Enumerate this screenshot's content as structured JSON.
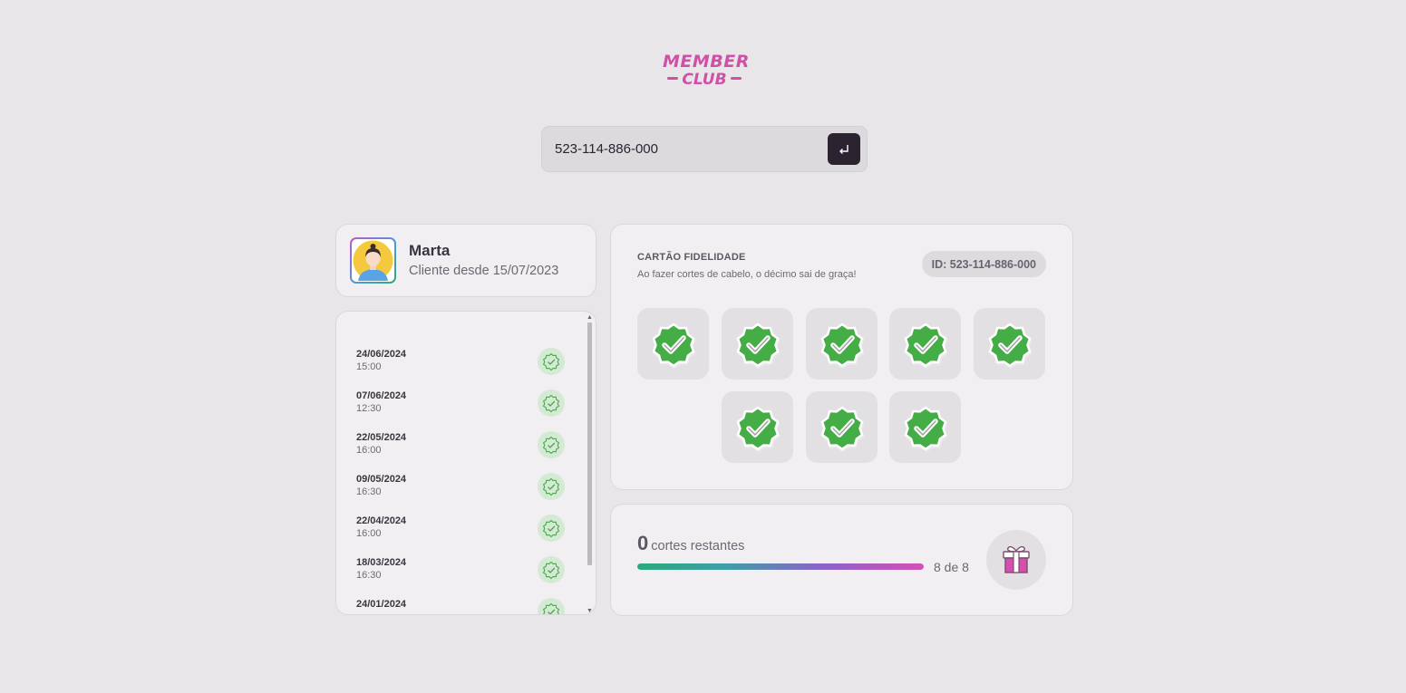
{
  "logo": {
    "line1": "MEMBER",
    "line2": "CLUB",
    "color": "#d050a8"
  },
  "search": {
    "value": "523-114-886-000",
    "submit_icon": "enter-arrow-icon"
  },
  "profile": {
    "name": "Marta",
    "since": "Cliente desde 15/07/2023",
    "avatar": "person-avatar"
  },
  "history": {
    "items": [
      {
        "date": "24/06/2024",
        "time": "15:00"
      },
      {
        "date": "07/06/2024",
        "time": "12:30"
      },
      {
        "date": "22/05/2024",
        "time": "16:00"
      },
      {
        "date": "09/05/2024",
        "time": "16:30"
      },
      {
        "date": "22/04/2024",
        "time": "16:00"
      },
      {
        "date": "18/03/2024",
        "time": "16:30"
      },
      {
        "date": "24/01/2024",
        "time": ""
      }
    ]
  },
  "loyalty": {
    "title": "CARTÃO FIDELIDADE",
    "subtitle": "Ao fazer cortes de cabelo, o décimo sai de graça!",
    "id_badge": "ID: 523-114-886-000",
    "stamps_filled": 8
  },
  "progress": {
    "remaining": "0",
    "remaining_label": "cortes restantes",
    "fraction_text": "8 de 8",
    "percent": 100,
    "gift_icon": "gift-icon"
  }
}
